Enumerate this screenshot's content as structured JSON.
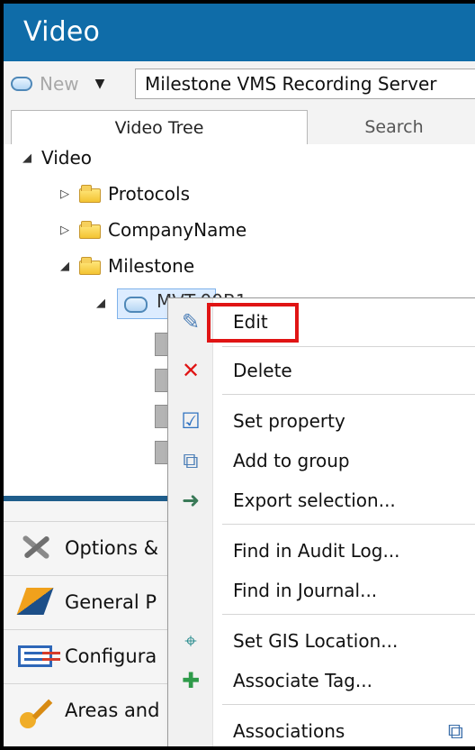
{
  "window": {
    "title": "Video"
  },
  "toolbar": {
    "new_label": "New",
    "server_value": "Milestone VMS Recording Server"
  },
  "tabs": [
    {
      "label": "Video Tree"
    },
    {
      "label": "Search"
    }
  ],
  "tree": {
    "root_label": "Video",
    "items": [
      {
        "label": "Protocols"
      },
      {
        "label": "CompanyName"
      },
      {
        "label": "Milestone"
      },
      {
        "label": "MVT-00B1"
      }
    ]
  },
  "left_nav": [
    {
      "label": "Options &",
      "icon": "tools-icon"
    },
    {
      "label": "General P",
      "icon": "flag-icon"
    },
    {
      "label": "Configura",
      "icon": "configuration-icon"
    },
    {
      "label": "Areas and",
      "icon": "key-icon"
    }
  ],
  "context_menu": {
    "items": [
      {
        "label": "Edit",
        "icon": "edit-icon"
      },
      {
        "label": "Delete",
        "icon": "delete-icon"
      },
      {
        "label": "Set property",
        "icon": "check-icon"
      },
      {
        "label": "Add to group",
        "icon": "group-icon"
      },
      {
        "label": "Export selection...",
        "icon": "export-icon"
      },
      {
        "label": "Find in Audit Log...",
        "icon": "audit-icon"
      },
      {
        "label": "Find in Journal...",
        "icon": "journal-icon"
      },
      {
        "label": "Set GIS Location...",
        "icon": "gis-icon"
      },
      {
        "label": "Associate Tag...",
        "icon": "tag-icon"
      },
      {
        "label": "Associations",
        "icon": "associations-icon"
      }
    ]
  },
  "colors": {
    "titlebar": "#0f6ca8",
    "highlight_box": "#e01414",
    "selected_item": "#dcecff"
  }
}
